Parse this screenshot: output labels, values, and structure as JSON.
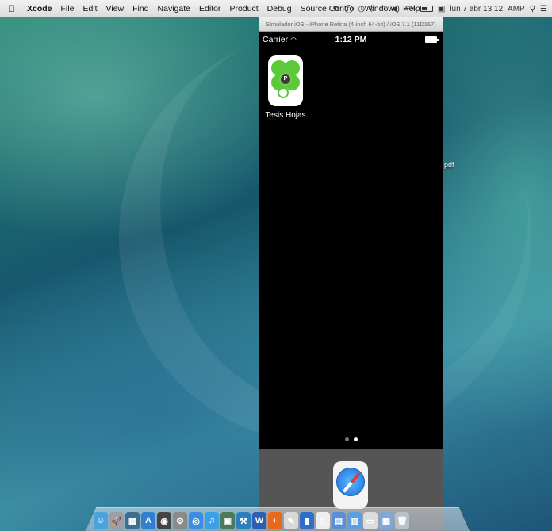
{
  "menubar": {
    "app_name": "Xcode",
    "items": [
      "File",
      "Edit",
      "View",
      "Find",
      "Navigate",
      "Editor",
      "Product",
      "Debug",
      "Source Control",
      "Window",
      "Help"
    ],
    "battery_percent": "48%",
    "datetime": "lun 7 abr 13:12",
    "user": "AMP"
  },
  "simulator": {
    "window_title": "Simulador iOS - iPhone Retina (4-inch 64-bit) / iOS 7.1 (11D167)",
    "carrier": "Carrier",
    "time": "1:12 PM",
    "app_label": "Tesis Hojas",
    "clover_letter": "P",
    "page_count": 2,
    "active_page": 2
  },
  "desktop": {
    "file_label": "pdf"
  },
  "dock": {
    "icons": [
      {
        "name": "finder-icon",
        "color": "#4aa3df",
        "glyph": "☺"
      },
      {
        "name": "launchpad-icon",
        "color": "#9aa0a6",
        "glyph": "🚀"
      },
      {
        "name": "mission-control-icon",
        "color": "#3b6e8f",
        "glyph": "▦"
      },
      {
        "name": "app-store-icon",
        "color": "#2f80d1",
        "glyph": "A"
      },
      {
        "name": "dashboard-icon",
        "color": "#444444",
        "glyph": "◉"
      },
      {
        "name": "system-prefs-icon",
        "color": "#8a8a8a",
        "glyph": "⚙"
      },
      {
        "name": "safari-dock-icon",
        "color": "#3a8ee6",
        "glyph": "◎"
      },
      {
        "name": "itunes-icon",
        "color": "#3aa0e8",
        "glyph": "♫"
      },
      {
        "name": "preview-icon",
        "color": "#4a7a5a",
        "glyph": "▣"
      },
      {
        "name": "xcode-icon",
        "color": "#2a7fc0",
        "glyph": "⚒"
      },
      {
        "name": "word-icon",
        "color": "#2b5fb3",
        "glyph": "W"
      },
      {
        "name": "firefox-icon",
        "color": "#e66a1a",
        "glyph": "◐"
      },
      {
        "name": "textedit-icon",
        "color": "#d9d9d9",
        "glyph": "✎"
      },
      {
        "name": "simulator-icon",
        "color": "#2a6fc8",
        "glyph": "▮"
      },
      {
        "name": "document-icon",
        "color": "#eeeeee",
        "glyph": "▯"
      },
      {
        "name": "folder-icon",
        "color": "#5a8fd8",
        "glyph": "▤"
      },
      {
        "name": "downloads-icon",
        "color": "#5aa0e0",
        "glyph": "▥"
      },
      {
        "name": "stack-icon",
        "color": "#dddddd",
        "glyph": "▭"
      },
      {
        "name": "window-icon",
        "color": "#7fa8d8",
        "glyph": "▦"
      },
      {
        "name": "trash-icon",
        "color": "#b8c0c8",
        "glyph": "🗑"
      }
    ]
  }
}
